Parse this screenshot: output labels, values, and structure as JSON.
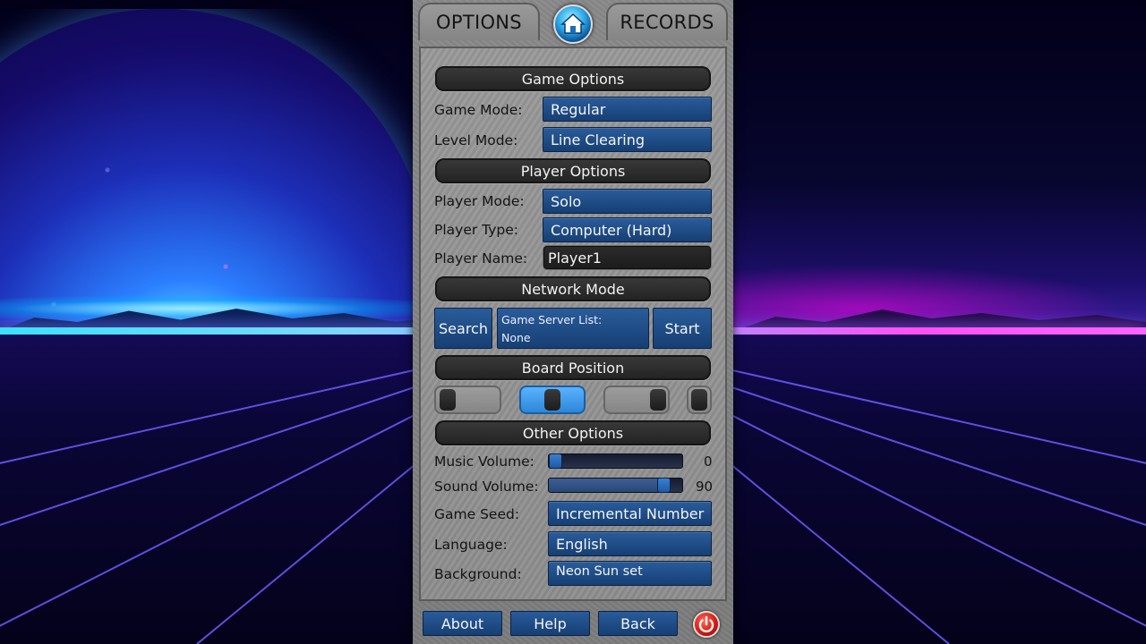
{
  "tabs": {
    "options": "OPTIONS",
    "records": "RECORDS"
  },
  "icons": {
    "home": "home-icon",
    "power": "power-icon"
  },
  "sections": {
    "game_options": "Game Options",
    "player_options": "Player Options",
    "network_mode": "Network Mode",
    "board_position": "Board Position",
    "other_options": "Other Options"
  },
  "game": {
    "mode_label": "Game Mode:",
    "mode_value": "Regular",
    "level_label": "Level Mode:",
    "level_value": "Line Clearing"
  },
  "player": {
    "mode_label": "Player Mode:",
    "mode_value": "Solo",
    "type_label": "Player Type:",
    "type_value": "Computer (Hard)",
    "name_label": "Player Name:",
    "name_value": "Player1"
  },
  "network": {
    "search": "Search",
    "server_list_label": "Game Server List:",
    "server_list_value": "None",
    "start": "Start"
  },
  "board_position": {
    "options": 4,
    "selected_index": 1
  },
  "other": {
    "music_label": "Music Volume:",
    "music_value": "0",
    "music_level": 0,
    "sound_label": "Sound Volume:",
    "sound_value": "90",
    "sound_level": 90,
    "seed_label": "Game Seed:",
    "seed_value": "Incremental Number",
    "language_label": "Language:",
    "language_value": "English",
    "background_label": "Background:",
    "background_value": "Neon Sun set"
  },
  "footer": {
    "about": "About",
    "help": "Help",
    "back": "Back"
  },
  "colors": {
    "button_blue": "#1f4e86",
    "header_dark": "#2b2b2b",
    "panel_gray": "#8c8c8c",
    "power_red": "#d91b12"
  }
}
